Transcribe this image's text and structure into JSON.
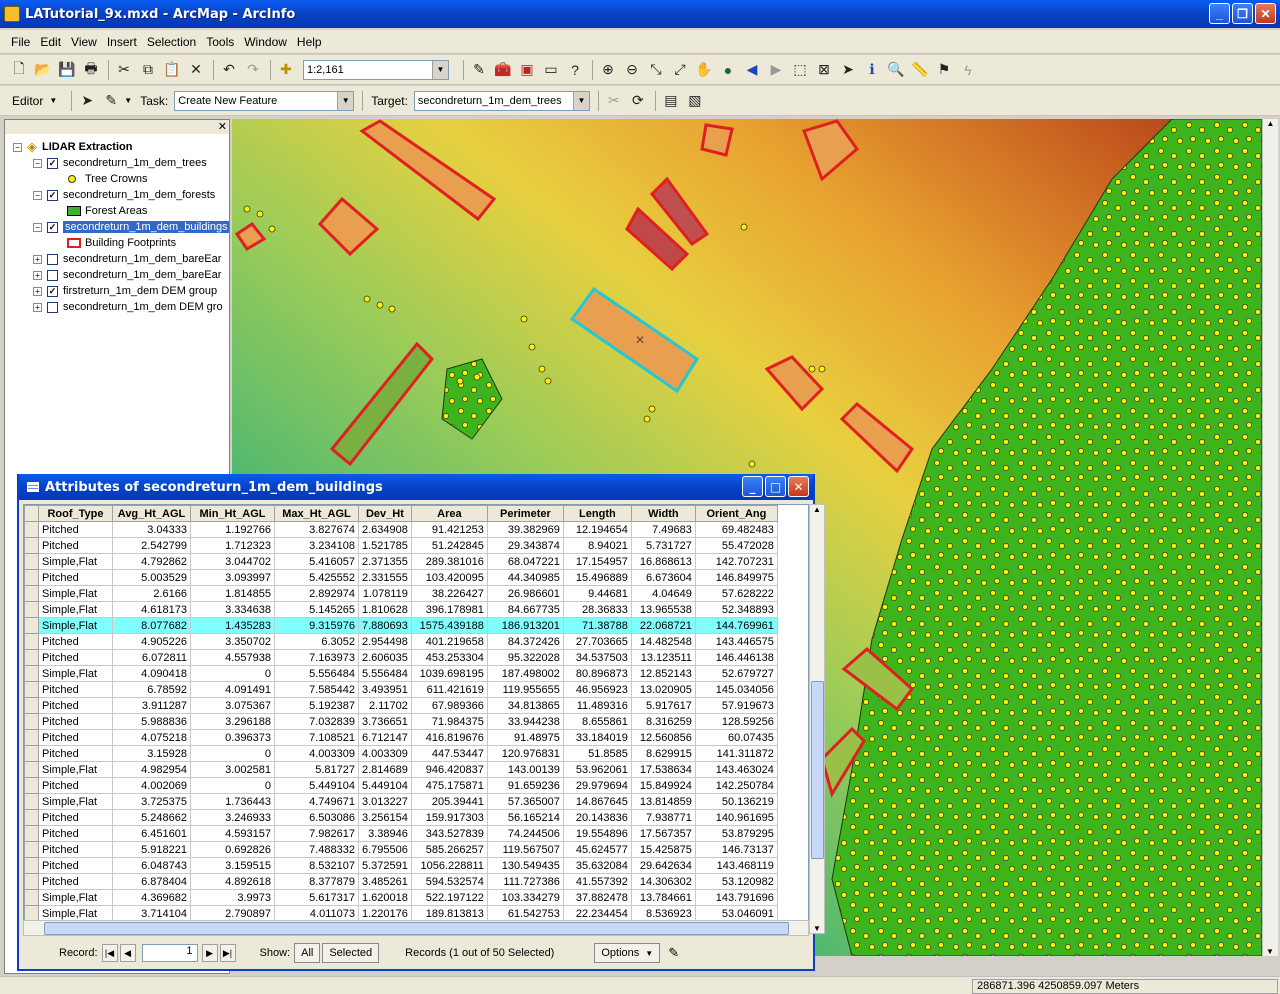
{
  "window": {
    "title": "LATutorial_9x.mxd - ArcMap - ArcInfo"
  },
  "menu": [
    "File",
    "Edit",
    "View",
    "Insert",
    "Selection",
    "Tools",
    "Window",
    "Help"
  ],
  "toolbar": {
    "scale": "1:2,161"
  },
  "editor": {
    "editor_label": "Editor",
    "task_label": "Task:",
    "task_value": "Create New Feature",
    "target_label": "Target:",
    "target_value": "secondreturn_1m_dem_trees"
  },
  "toc": {
    "frame": "LIDAR Extraction",
    "layers": [
      {
        "name": "secondreturn_1m_dem_trees",
        "checked": true,
        "expanded": true,
        "legend": "Tree Crowns"
      },
      {
        "name": "secondreturn_1m_dem_forests",
        "checked": true,
        "expanded": true,
        "legend": "Forest Areas"
      },
      {
        "name": "secondreturn_1m_dem_buildings",
        "checked": true,
        "expanded": true,
        "legend": "Building Footprints"
      },
      {
        "name": "secondreturn_1m_dem_bareEar",
        "checked": false,
        "expanded": false
      },
      {
        "name": "secondreturn_1m_dem_bareEar",
        "checked": false,
        "expanded": false
      },
      {
        "name": "firstreturn_1m_dem DEM group",
        "checked": true,
        "expanded": false
      },
      {
        "name": "secondreturn_1m_dem DEM gro",
        "checked": false,
        "expanded": false
      }
    ]
  },
  "attributes": {
    "title": "Attributes of secondreturn_1m_dem_buildings",
    "columns": [
      "Roof_Type",
      "Avg_Ht_AGL",
      "Min_Ht_AGL",
      "Max_Ht_AGL",
      "Dev_Ht",
      "Area",
      "Perimeter",
      "Length",
      "Width",
      "Orient_Ang"
    ],
    "rows": [
      [
        "Pitched",
        "3.04333",
        "1.192766",
        "3.827674",
        "2.634908",
        "91.421253",
        "39.382969",
        "12.194654",
        "7.49683",
        "69.482483"
      ],
      [
        "Pitched",
        "2.542799",
        "1.712323",
        "3.234108",
        "1.521785",
        "51.242845",
        "29.343874",
        "8.94021",
        "5.731727",
        "55.472028"
      ],
      [
        "Simple,Flat",
        "4.792862",
        "3.044702",
        "5.416057",
        "2.371355",
        "289.381016",
        "68.047221",
        "17.154957",
        "16.868613",
        "142.707231"
      ],
      [
        "Pitched",
        "5.003529",
        "3.093997",
        "5.425552",
        "2.331555",
        "103.420095",
        "44.340985",
        "15.496889",
        "6.673604",
        "146.849975"
      ],
      [
        "Simple,Flat",
        "2.6166",
        "1.814855",
        "2.892974",
        "1.078119",
        "38.226427",
        "26.986601",
        "9.44681",
        "4.04649",
        "57.628222"
      ],
      [
        "Simple,Flat",
        "4.618173",
        "3.334638",
        "5.145265",
        "1.810628",
        "396.178981",
        "84.667735",
        "28.36833",
        "13.965538",
        "52.348893"
      ],
      [
        "Simple,Flat",
        "8.077682",
        "1.435283",
        "9.315976",
        "7.880693",
        "1575.439188",
        "186.913201",
        "71.38788",
        "22.068721",
        "144.769961"
      ],
      [
        "Pitched",
        "4.905226",
        "3.350702",
        "6.3052",
        "2.954498",
        "401.219658",
        "84.372426",
        "27.703665",
        "14.482548",
        "143.446575"
      ],
      [
        "Pitched",
        "6.072811",
        "4.557938",
        "7.163973",
        "2.606035",
        "453.253304",
        "95.322028",
        "34.537503",
        "13.123511",
        "146.446138"
      ],
      [
        "Simple,Flat",
        "4.090418",
        "0",
        "5.556484",
        "5.556484",
        "1039.698195",
        "187.498002",
        "80.896873",
        "12.852143",
        "52.679727"
      ],
      [
        "Pitched",
        "6.78592",
        "4.091491",
        "7.585442",
        "3.493951",
        "611.421619",
        "119.955655",
        "46.956923",
        "13.020905",
        "145.034056"
      ],
      [
        "Pitched",
        "3.911287",
        "3.075367",
        "5.192387",
        "2.11702",
        "67.989366",
        "34.813865",
        "11.489316",
        "5.917617",
        "57.919673"
      ],
      [
        "Pitched",
        "5.988836",
        "3.296188",
        "7.032839",
        "3.736651",
        "71.984375",
        "33.944238",
        "8.655861",
        "8.316259",
        "128.59256"
      ],
      [
        "Pitched",
        "4.075218",
        "0.396373",
        "7.108521",
        "6.712147",
        "416.819676",
        "91.48975",
        "33.184019",
        "12.560856",
        "60.07435"
      ],
      [
        "Pitched",
        "3.15928",
        "0",
        "4.003309",
        "4.003309",
        "447.53447",
        "120.976831",
        "51.8585",
        "8.629915",
        "141.311872"
      ],
      [
        "Simple,Flat",
        "4.982954",
        "3.002581",
        "5.81727",
        "2.814689",
        "946.420837",
        "143.00139",
        "53.962061",
        "17.538634",
        "143.463024"
      ],
      [
        "Pitched",
        "4.002069",
        "0",
        "5.449104",
        "5.449104",
        "475.175871",
        "91.659236",
        "29.979694",
        "15.849924",
        "142.250784"
      ],
      [
        "Simple,Flat",
        "3.725375",
        "1.736443",
        "4.749671",
        "3.013227",
        "205.39441",
        "57.365007",
        "14.867645",
        "13.814859",
        "50.136219"
      ],
      [
        "Pitched",
        "5.248662",
        "3.246933",
        "6.503086",
        "3.256154",
        "159.917303",
        "56.165214",
        "20.143836",
        "7.938771",
        "140.961695"
      ],
      [
        "Pitched",
        "6.451601",
        "4.593157",
        "7.982617",
        "3.38946",
        "343.527839",
        "74.244506",
        "19.554896",
        "17.567357",
        "53.879295"
      ],
      [
        "Pitched",
        "5.918221",
        "0.692826",
        "7.488332",
        "6.795506",
        "585.266257",
        "119.567507",
        "45.624577",
        "15.425875",
        "146.73137"
      ],
      [
        "Pitched",
        "6.048743",
        "3.159515",
        "8.532107",
        "5.372591",
        "1056.228811",
        "130.549435",
        "35.632084",
        "29.642634",
        "143.468119"
      ],
      [
        "Pitched",
        "6.878404",
        "4.892618",
        "8.377879",
        "3.485261",
        "594.532574",
        "111.727386",
        "41.557392",
        "14.306302",
        "53.120982"
      ],
      [
        "Simple,Flat",
        "4.369682",
        "3.9973",
        "5.617317",
        "1.620018",
        "522.197122",
        "103.334279",
        "37.882478",
        "13.784661",
        "143.791696"
      ],
      [
        "Simple,Flat",
        "3.714104",
        "2.790897",
        "4.011073",
        "1.220176",
        "189.813813",
        "61.542753",
        "22.234454",
        "8.536923",
        "53.046091"
      ]
    ],
    "selected_row_index": 6,
    "record_label": "Record:",
    "record_value": "1",
    "show_label": "Show:",
    "show_all": "All",
    "show_selected": "Selected",
    "records_text": "Records (1 out of 50 Selected)",
    "options_label": "Options"
  },
  "status": {
    "coords": "286871.396  4250859.097 Meters"
  }
}
